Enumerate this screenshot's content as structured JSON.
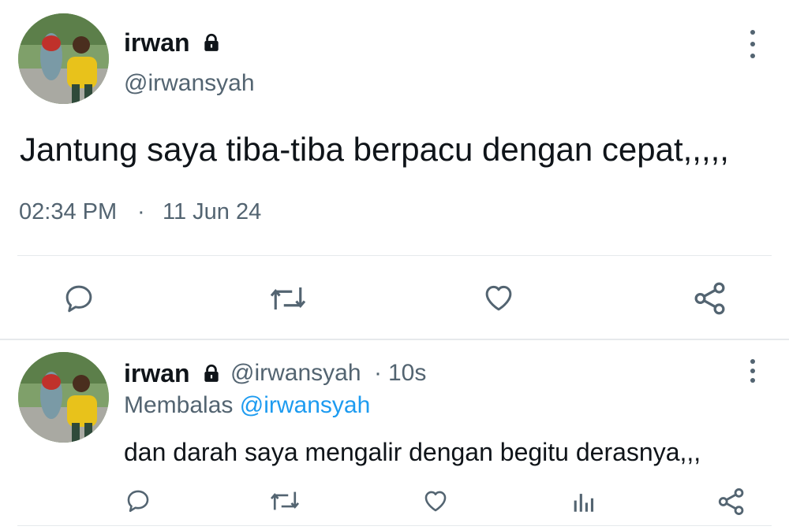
{
  "main_tweet": {
    "display_name": "irwan",
    "handle": "@irwansyah",
    "text": "Jantung saya tiba-tiba berpacu dengan cepat,,,,,",
    "time": "02:34 PM",
    "separator": "·",
    "date": "11 Jun 24",
    "actions": [
      "reply-icon",
      "retweet-icon",
      "like-icon",
      "share-icon"
    ]
  },
  "reply_tweet": {
    "display_name": "irwan",
    "handle": "@irwansyah",
    "dot": "·",
    "age": "10s",
    "replying_prefix": "Membalas",
    "replying_to": "@irwansyah",
    "text": "dan darah saya mengalir dengan begitu derasnya,,,",
    "actions": [
      "reply-icon",
      "retweet-icon",
      "like-icon",
      "analytics-icon",
      "share-icon"
    ]
  },
  "colors": {
    "text": "#0f1419",
    "muted": "#536471",
    "link": "#1d9bf0",
    "divider": "#e6e9ec"
  }
}
